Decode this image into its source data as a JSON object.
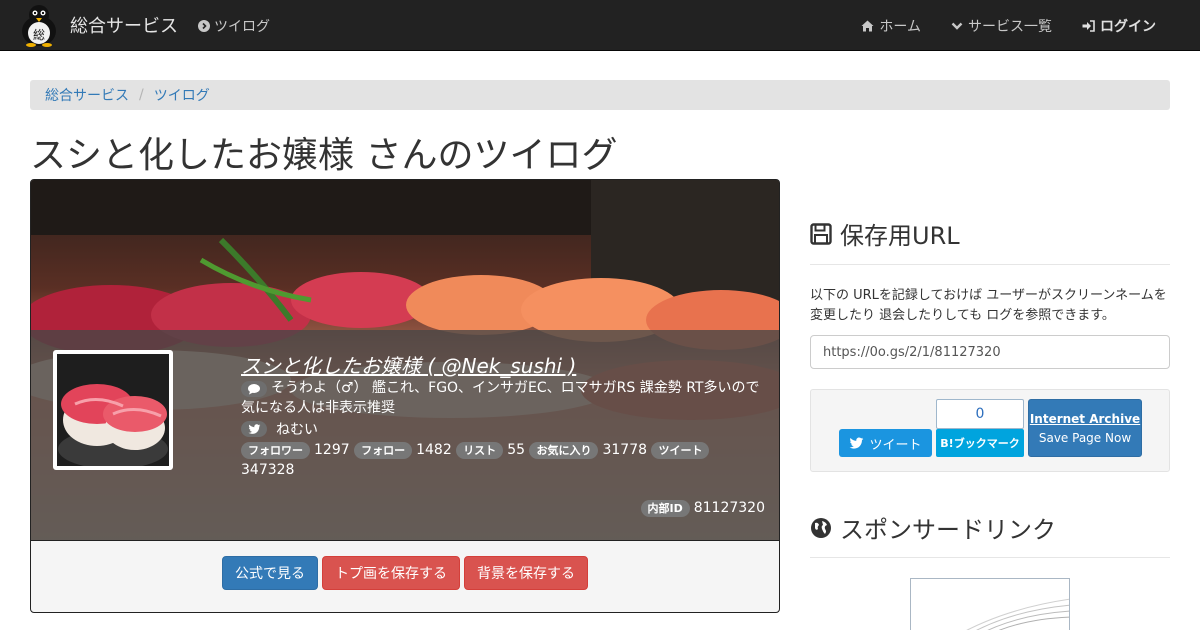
{
  "navbar": {
    "brand": "総合サービス",
    "logo_char": "総",
    "twilog_link": "ツイログ",
    "items": [
      {
        "label": "ホーム",
        "icon": "home-icon"
      },
      {
        "label": "サービス一覧",
        "icon": "chevron-down-icon"
      },
      {
        "label": "ログイン",
        "icon": "sign-in-icon"
      }
    ]
  },
  "breadcrumb": {
    "items": [
      "総合サービス",
      "ツイログ"
    ],
    "separator": "/"
  },
  "page_title": "スシと化したお嬢様 さんのツイログ",
  "profile": {
    "name": "スシと化したお嬢様 ( @Nek_sushi )",
    "bio": "そうわよ（♂） 艦これ、FGO、インサガEC、ロマサガRS 課金勢 RT多いので気になる人は非表示推奨",
    "location": "ねむい",
    "stats": [
      {
        "label": "フォロワー",
        "value": "1297"
      },
      {
        "label": "フォロー",
        "value": "1482"
      },
      {
        "label": "リスト",
        "value": "55"
      },
      {
        "label": "お気に入り",
        "value": "31778"
      },
      {
        "label": "ツイート",
        "value": "347328"
      }
    ],
    "internal_id_label": "内部ID",
    "internal_id": "81127320"
  },
  "card_buttons": {
    "official": "公式で見る",
    "save_icon": "トプ画を保存する",
    "save_bg": "背景を保存する"
  },
  "save_section": {
    "title": "保存用URL",
    "description": "以下の URLを記録しておけば ユーザーがスクリーンネームを変更したり 退会したりしても ログを参照できます。",
    "url": "https://0o.gs/2/1/81127320"
  },
  "share": {
    "tweet": "ツイート",
    "hatena_count": "0",
    "hatena": "B!ブックマーク",
    "ia_title": "Internet Archive",
    "ia_sub": "Save Page Now"
  },
  "sponsor_title": "スポンサードリンク",
  "colors": {
    "navbar": "#222222",
    "link": "#337ab7",
    "primary": "#337ab7",
    "danger": "#d9534f",
    "twitter": "#1b95e0",
    "hatena": "#00a4de"
  }
}
